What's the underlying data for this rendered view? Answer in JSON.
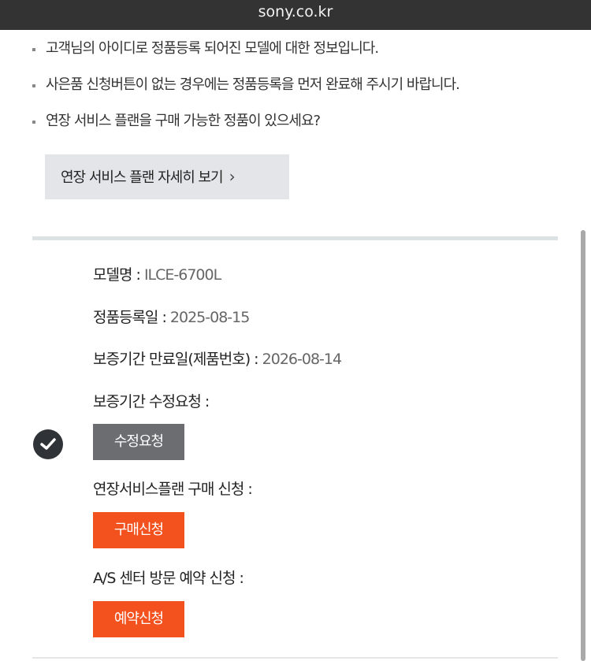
{
  "browser": {
    "url": "sony.co.kr"
  },
  "notes": [
    "고객님의 아이디로 정품등록 되어진 모델에 대한 정보입니다.",
    "사은품 신청버튼이 없는 경우에는 정품등록을 먼저 완료해 주시기 바랍니다.",
    "연장 서비스 플랜을 구매 가능한 정품이 있으세요?"
  ],
  "plan_button": {
    "label": "연장 서비스 플랜 자세히 보기",
    "chevron": "›"
  },
  "product": {
    "model_label": "모델명 :",
    "model_value": "ILCE-6700L",
    "registered_label": "정품등록일 :",
    "registered_value": "2025-08-15",
    "warranty_label": "보증기간 만료일(제품번호) :",
    "warranty_value": "2026-08-14",
    "modify_label": "보증기간 수정요청 :",
    "modify_button": "수정요청",
    "extend_label": "연장서비스플랜 구매 신청 :",
    "extend_button": "구매신청",
    "as_label": "A/S 센터 방문 예약 신청 :",
    "as_button": "예약신청"
  },
  "icons": {
    "check": "check-circle-icon"
  },
  "colors": {
    "url_bar": "#333333",
    "plan_button_bg": "#e3e5e8",
    "grey_button": "#6c6d70",
    "accent_orange": "#f3521f",
    "divider": "#dde3e5"
  }
}
